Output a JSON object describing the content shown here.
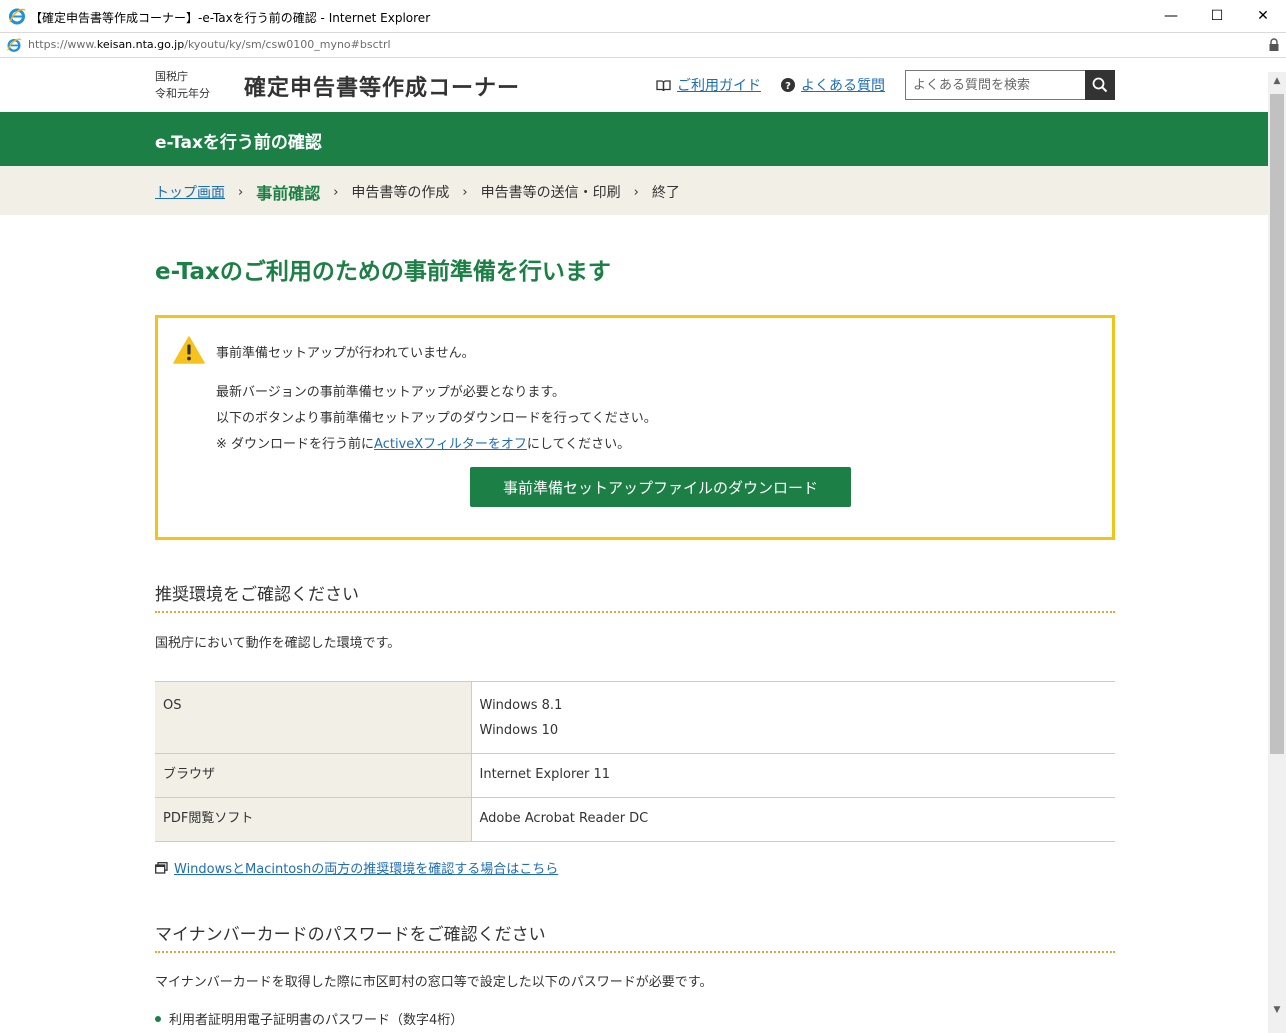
{
  "window": {
    "title": "【確定申告書等作成コーナー】-e-Taxを行う前の確認 - Internet Explorer",
    "minimize": "—",
    "maximize": "☐",
    "close": "✕"
  },
  "address": {
    "scheme": "https://www.",
    "host": "keisan.nta.go.jp",
    "path": "/kyoutu/ky/sm/csw0100_myno#bsctrl"
  },
  "header": {
    "agency_line1": "国税庁",
    "agency_line2": "令和元年分",
    "site_title": "確定申告書等作成コーナー",
    "guide_label": "ご利用ガイド",
    "faq_label": "よくある質問",
    "search_placeholder": "よくある質問を検索"
  },
  "greenbar": {
    "title": "e-Taxを行う前の確認"
  },
  "breadcrumb": {
    "items": [
      "トップ画面",
      "事前確認",
      "申告書等の作成",
      "申告書等の送信・印刷",
      "終了"
    ],
    "separator": "›"
  },
  "main": {
    "heading": "e-Taxのご利用のための事前準備を行います",
    "notice": {
      "status": "事前準備セットアップが行われていません。",
      "line1": "最新バージョンの事前準備セットアップが必要となります。",
      "line2": "以下のボタンより事前準備セットアップのダウンロードを行ってください。",
      "line3_prefix": "※ ダウンロードを行う前に",
      "line3_link": "ActiveXフィルターをオフ",
      "line3_suffix": "にしてください。",
      "download_button": "事前準備セットアップファイルのダウンロード"
    },
    "env_section": {
      "title": "推奨環境をご確認ください",
      "description": "国税庁において動作を確認した環境です。",
      "rows": [
        {
          "label": "OS",
          "values": [
            "Windows 8.1",
            "Windows 10"
          ]
        },
        {
          "label": "ブラウザ",
          "values": [
            "Internet Explorer 11"
          ]
        },
        {
          "label": "PDF閲覧ソフト",
          "values": [
            "Adobe Acrobat Reader DC"
          ]
        }
      ],
      "both_link": "WindowsとMacintoshの両方の推奨環境を確認する場合はこちら"
    },
    "password_section": {
      "title": "マイナンバーカードのパスワードをご確認ください",
      "description": "マイナンバーカードを取得した際に市区町村の窓口等で設定した以下のパスワードが必要です。",
      "items": [
        "利用者証明用電子証明書のパスワード（数字4桁）"
      ]
    }
  },
  "colors": {
    "brand_green": "#1c7f46",
    "notice_border": "#f0c419",
    "crumb_bg": "#f1efe6",
    "link": "#1d6db5"
  }
}
